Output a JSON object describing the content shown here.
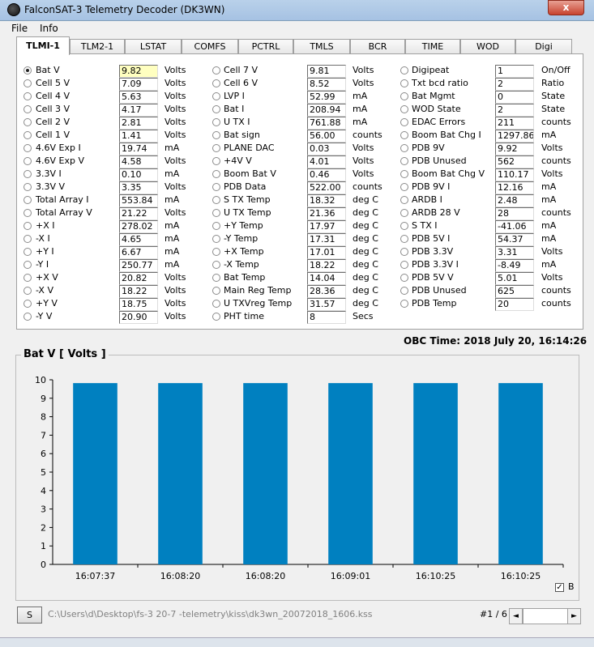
{
  "window": {
    "title": "FalconSAT-3 Telemetry Decoder (DK3WN)",
    "close_label": "x"
  },
  "menu": {
    "file": "File",
    "info": "Info"
  },
  "tabs": [
    "TLMI-1",
    "TLM2-1",
    "LSTAT",
    "COMFS",
    "PCTRL",
    "TMLS",
    "BCR",
    "TIME",
    "WOD",
    "Digi"
  ],
  "active_tab": 0,
  "telemetry": {
    "col1": [
      {
        "label": "Bat V",
        "value": "9.82",
        "unit": "Volts",
        "selected": true
      },
      {
        "label": "Cell 5 V",
        "value": "7.09",
        "unit": "Volts"
      },
      {
        "label": "Cell 4 V",
        "value": "5.63",
        "unit": "Volts"
      },
      {
        "label": "Cell 3 V",
        "value": "4.17",
        "unit": "Volts"
      },
      {
        "label": "Cell 2 V",
        "value": "2.81",
        "unit": "Volts"
      },
      {
        "label": "Cell 1 V",
        "value": "1.41",
        "unit": "Volts"
      },
      {
        "label": "4.6V Exp I",
        "value": "19.74",
        "unit": "mA"
      },
      {
        "label": "4.6V Exp V",
        "value": "4.58",
        "unit": "Volts"
      },
      {
        "label": "3.3V I",
        "value": "0.10",
        "unit": "mA"
      },
      {
        "label": "3.3V V",
        "value": "3.35",
        "unit": "Volts"
      },
      {
        "label": "Total Array I",
        "value": "553.84",
        "unit": "mA"
      },
      {
        "label": "Total Array V",
        "value": "21.22",
        "unit": "Volts"
      },
      {
        "label": "+X I",
        "value": "278.02",
        "unit": "mA"
      },
      {
        "label": "-X I",
        "value": "4.65",
        "unit": "mA"
      },
      {
        "label": "+Y I",
        "value": "6.67",
        "unit": "mA"
      },
      {
        "label": "-Y I",
        "value": "250.77",
        "unit": "mA"
      },
      {
        "label": "+X V",
        "value": "20.82",
        "unit": "Volts"
      },
      {
        "label": "-X V",
        "value": "18.22",
        "unit": "Volts"
      },
      {
        "label": "+Y V",
        "value": "18.75",
        "unit": "Volts"
      },
      {
        "label": "-Y V",
        "value": "20.90",
        "unit": "Volts"
      }
    ],
    "col2": [
      {
        "label": "Cell 7 V",
        "value": "9.81",
        "unit": "Volts"
      },
      {
        "label": "Cell 6 V",
        "value": "8.52",
        "unit": "Volts"
      },
      {
        "label": "LVP I",
        "value": "52.99",
        "unit": "mA"
      },
      {
        "label": "Bat I",
        "value": "208.94",
        "unit": "mA"
      },
      {
        "label": "U TX I",
        "value": "761.88",
        "unit": "mA"
      },
      {
        "label": "Bat sign",
        "value": "56.00",
        "unit": "counts"
      },
      {
        "label": "PLANE DAC",
        "value": "0.03",
        "unit": "Volts"
      },
      {
        "label": "+4V V",
        "value": "4.01",
        "unit": "Volts"
      },
      {
        "label": "Boom Bat V",
        "value": "0.46",
        "unit": "Volts"
      },
      {
        "label": "PDB Data",
        "value": "522.00",
        "unit": "counts"
      },
      {
        "label": "S TX Temp",
        "value": "18.32",
        "unit": "deg C"
      },
      {
        "label": "U TX Temp",
        "value": "21.36",
        "unit": "deg C"
      },
      {
        "label": "+Y Temp",
        "value": "17.97",
        "unit": "deg C"
      },
      {
        "label": "-Y Temp",
        "value": "17.31",
        "unit": "deg C"
      },
      {
        "label": "+X Temp",
        "value": "17.01",
        "unit": "deg C"
      },
      {
        "label": "-X Temp",
        "value": "18.22",
        "unit": "deg C"
      },
      {
        "label": "Bat Temp",
        "value": "14.04",
        "unit": "deg C"
      },
      {
        "label": "Main Reg Temp",
        "value": "28.36",
        "unit": "deg C"
      },
      {
        "label": "U TXVreg Temp",
        "value": "31.57",
        "unit": "deg C"
      },
      {
        "label": "PHT time",
        "value": "8",
        "unit": "Secs"
      }
    ],
    "col3": [
      {
        "label": "Digipeat",
        "value": "1",
        "unit": "On/Off"
      },
      {
        "label": "Txt bcd ratio",
        "value": "2",
        "unit": "Ratio"
      },
      {
        "label": "Bat Mgmt",
        "value": "0",
        "unit": "State"
      },
      {
        "label": "WOD State",
        "value": "2",
        "unit": "State"
      },
      {
        "label": "EDAC Errors",
        "value": "211",
        "unit": "counts"
      },
      {
        "label": "Boom Bat Chg I",
        "value": "1297.86",
        "unit": "mA"
      },
      {
        "label": "PDB 9V",
        "value": "9.92",
        "unit": "Volts"
      },
      {
        "label": "PDB Unused",
        "value": "562",
        "unit": "counts"
      },
      {
        "label": "Boom Bat Chg V",
        "value": "110.17",
        "unit": "Volts"
      },
      {
        "label": "PDB 9V I",
        "value": "12.16",
        "unit": "mA"
      },
      {
        "label": "ARDB I",
        "value": "2.48",
        "unit": "mA"
      },
      {
        "label": "ARDB 28 V",
        "value": "28",
        "unit": "counts"
      },
      {
        "label": "S TX I",
        "value": "-41.06",
        "unit": "mA"
      },
      {
        "label": "PDB 5V I",
        "value": "54.37",
        "unit": "mA"
      },
      {
        "label": "PDB 3.3V",
        "value": "3.31",
        "unit": "Volts"
      },
      {
        "label": "PDB 3.3V I",
        "value": "-8.49",
        "unit": "mA"
      },
      {
        "label": "PDB 5V V",
        "value": "5.01",
        "unit": "Volts"
      },
      {
        "label": "PDB Unused",
        "value": "625",
        "unit": "counts"
      },
      {
        "label": "PDB Temp",
        "value": "20",
        "unit": "counts"
      }
    ]
  },
  "obc_time": "OBC Time: 2018 July 20, 16:14:26",
  "chart_caption": "Bat V  [ Volts ]",
  "legend": {
    "label": "B",
    "checked": true,
    "check_mark": "✓"
  },
  "chart_data": {
    "type": "bar",
    "title": "Bat V  [ Volts ]",
    "categories": [
      "16:07:37",
      "16:08:20",
      "16:08:20",
      "16:09:01",
      "16:10:25",
      "16:10:25"
    ],
    "series": [
      {
        "name": "B",
        "values": [
          9.82,
          9.82,
          9.82,
          9.82,
          9.82,
          9.82
        ]
      }
    ],
    "ylim": [
      0,
      10
    ],
    "yticks": [
      0,
      1,
      2,
      3,
      4,
      5,
      6,
      7,
      8,
      9,
      10
    ],
    "color": "#0080c0",
    "grid": false,
    "legend": "bottom-right"
  },
  "status": {
    "button_label": "S",
    "file_path": "C:\\Users\\d\\Desktop\\fs-3 20-7 -telemetry\\kiss\\dk3wn_20072018_1606.kss",
    "page_counter": "#1 / 6",
    "scroll_left": "◄",
    "scroll_right": "►"
  }
}
